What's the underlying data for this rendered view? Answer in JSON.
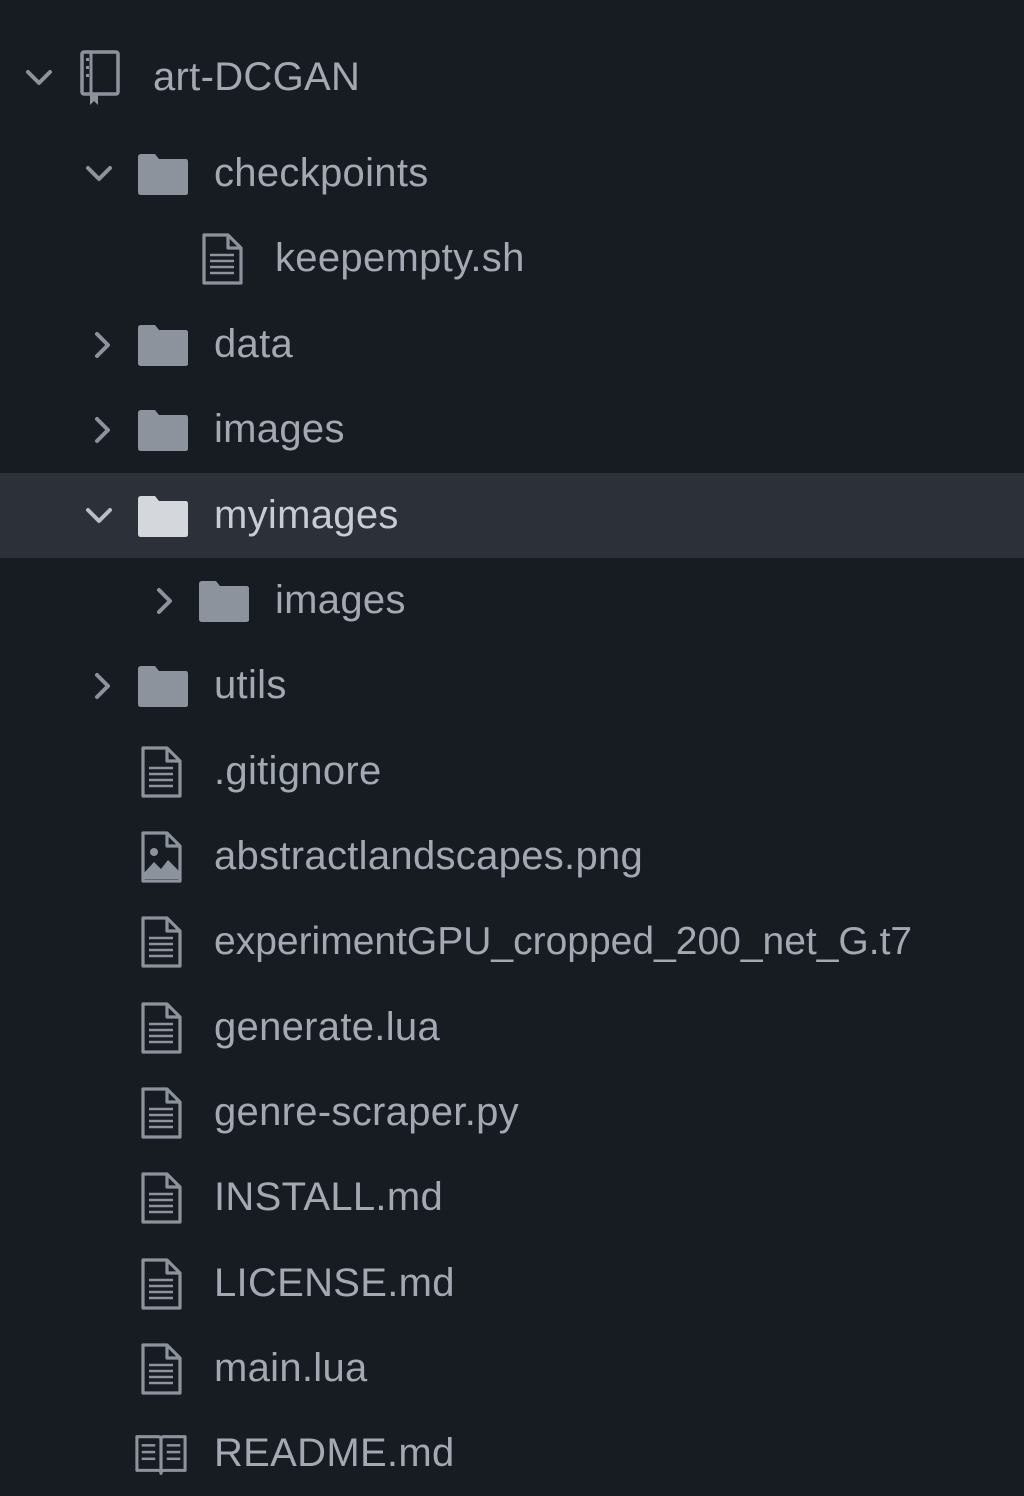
{
  "project": {
    "name": "art-DCGAN"
  },
  "tree": [
    {
      "label": "checkpoints",
      "type": "folder",
      "expanded": true,
      "depth": 1
    },
    {
      "label": "keepempty.sh",
      "type": "file",
      "depth": 2
    },
    {
      "label": "data",
      "type": "folder",
      "expanded": false,
      "depth": 1
    },
    {
      "label": "images",
      "type": "folder",
      "expanded": false,
      "depth": 1
    },
    {
      "label": "myimages",
      "type": "folder",
      "expanded": true,
      "selected": true,
      "depth": 1
    },
    {
      "label": "images",
      "type": "folder",
      "expanded": false,
      "depth": 2
    },
    {
      "label": "utils",
      "type": "folder",
      "expanded": false,
      "depth": 1
    },
    {
      "label": ".gitignore",
      "type": "file",
      "depth": 1
    },
    {
      "label": "abstractlandscapes.png",
      "type": "image",
      "depth": 1
    },
    {
      "label": "experimentGPU_cropped_200_net_G.t7",
      "type": "file",
      "depth": 1
    },
    {
      "label": "generate.lua",
      "type": "file",
      "depth": 1
    },
    {
      "label": "genre-scraper.py",
      "type": "file",
      "depth": 1
    },
    {
      "label": "INSTALL.md",
      "type": "file",
      "depth": 1
    },
    {
      "label": "LICENSE.md",
      "type": "file",
      "depth": 1
    },
    {
      "label": "main.lua",
      "type": "file",
      "depth": 1
    },
    {
      "label": "README.md",
      "type": "book",
      "depth": 1
    }
  ],
  "icons": {
    "root": "repo-icon",
    "folder": "folder-icon",
    "file": "file-text-icon",
    "image": "file-media-icon",
    "book": "book-icon",
    "expanded": "chevron-down-icon",
    "collapsed": "chevron-right-icon"
  },
  "colors": {
    "background": "#171b22",
    "selected_row": "#2c3038",
    "text": "#a3a9b3",
    "icon": "#8d939d",
    "selected_icon": "#d4d7dc"
  }
}
